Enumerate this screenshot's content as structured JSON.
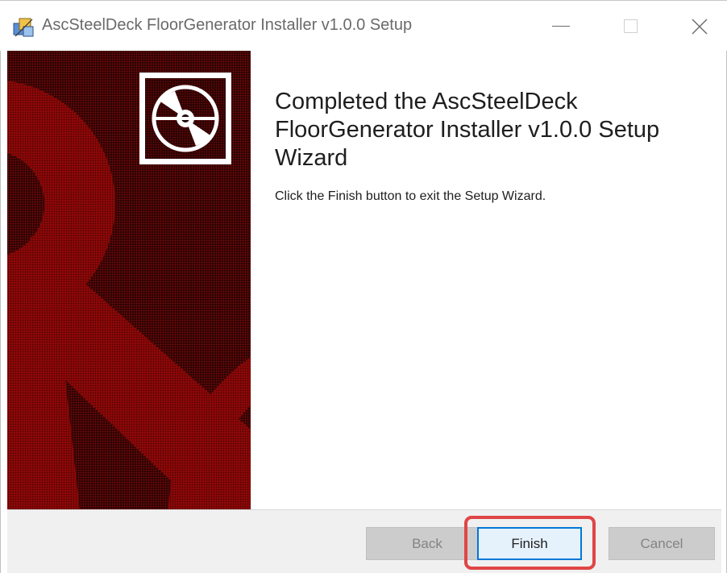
{
  "window": {
    "title": "AscSteelDeck FloorGenerator Installer v1.0.0 Setup",
    "icon": "installer-package-icon"
  },
  "content": {
    "heading": "Completed the AscSteelDeck FloorGenerator Installer v1.0.0 Setup Wizard",
    "subtext": "Click the Finish button to exit the Setup Wizard."
  },
  "buttons": {
    "back_label": "Back",
    "finish_label": "Finish",
    "cancel_label": "Cancel"
  },
  "colors": {
    "banner_dark": "#1c0303",
    "banner_red": "#7a0808",
    "focus_blue": "#0078d7",
    "highlight_red": "#e04545"
  }
}
